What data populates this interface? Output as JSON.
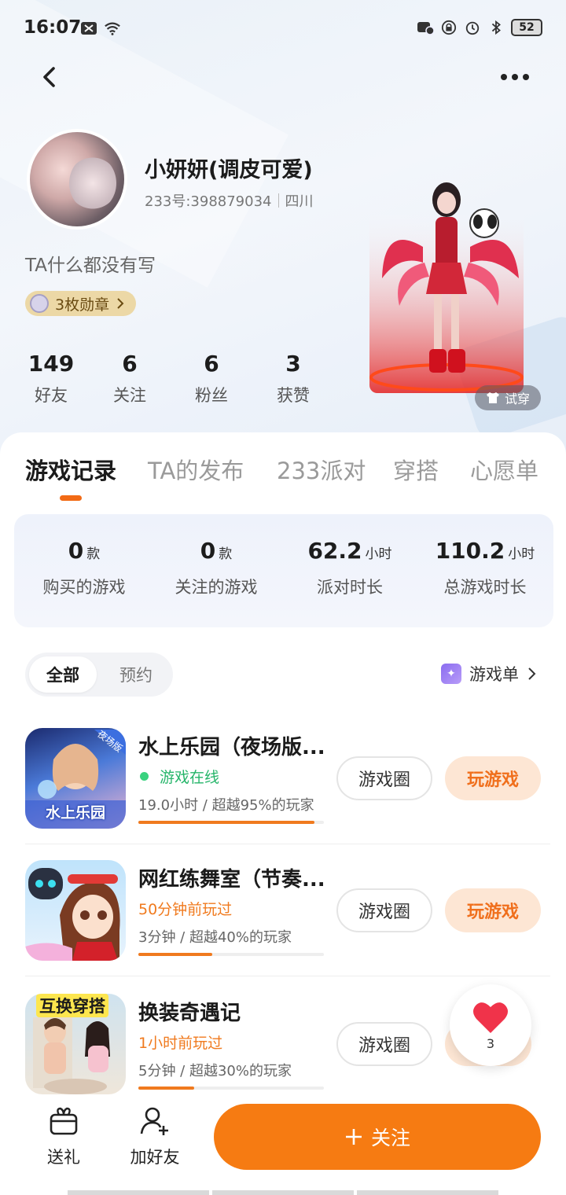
{
  "status_bar": {
    "time": "16:07",
    "battery": "52"
  },
  "profile": {
    "nickname": "小妍妍(调皮可爱)",
    "id_text": "233号:398879034",
    "location": "四川",
    "bio": "TA什么都没有写",
    "medal_label": "3枚勋章",
    "stats": [
      {
        "value": "149",
        "label": "好友"
      },
      {
        "value": "6",
        "label": "关注"
      },
      {
        "value": "6",
        "label": "粉丝"
      },
      {
        "value": "3",
        "label": "获赞"
      }
    ],
    "try_on_label": "试穿"
  },
  "tabs": [
    {
      "label": "游戏记录",
      "active": true
    },
    {
      "label": "TA的发布",
      "active": false
    },
    {
      "label": "233派对",
      "active": false
    },
    {
      "label": "穿搭",
      "active": false
    },
    {
      "label": "心愿单",
      "active": false
    }
  ],
  "summary": [
    {
      "value": "0",
      "unit": "款",
      "label": "购买的游戏"
    },
    {
      "value": "0",
      "unit": "款",
      "label": "关注的游戏"
    },
    {
      "value": "62.2",
      "unit": "小时",
      "label": "派对时长"
    },
    {
      "value": "110.2",
      "unit": "小时",
      "label": "总游戏时长"
    }
  ],
  "filter": {
    "all": "全部",
    "reserve": "预约"
  },
  "game_list_link": "游戏单",
  "games": [
    {
      "title": "水上乐园（夜场版...",
      "status": "游戏在线",
      "stat": "19.0小时 / 超越95%的玩家",
      "progress": 0.95,
      "circle": "游戏圈",
      "play": "玩游戏",
      "icon_text": "水上乐园",
      "icon_badge": "夜场版"
    },
    {
      "title": "网红练舞室（节奏...",
      "status": "50分钟前玩过",
      "stat": "3分钟 / 超越40%的玩家",
      "progress": 0.4,
      "circle": "游戏圈",
      "play": "玩游戏"
    },
    {
      "title": "换装奇遇记",
      "status": "1小时前玩过",
      "stat": "5分钟 / 超越30%的玩家",
      "progress": 0.3,
      "circle": "游戏圈",
      "play": "",
      "icon_text": "互换穿搭"
    }
  ],
  "like": {
    "count": "3"
  },
  "bottom_bar": {
    "gift": "送礼",
    "add_friend": "加好友",
    "follow": "关注"
  },
  "colors": {
    "accent": "#f67b12",
    "online": "#26b56a"
  }
}
